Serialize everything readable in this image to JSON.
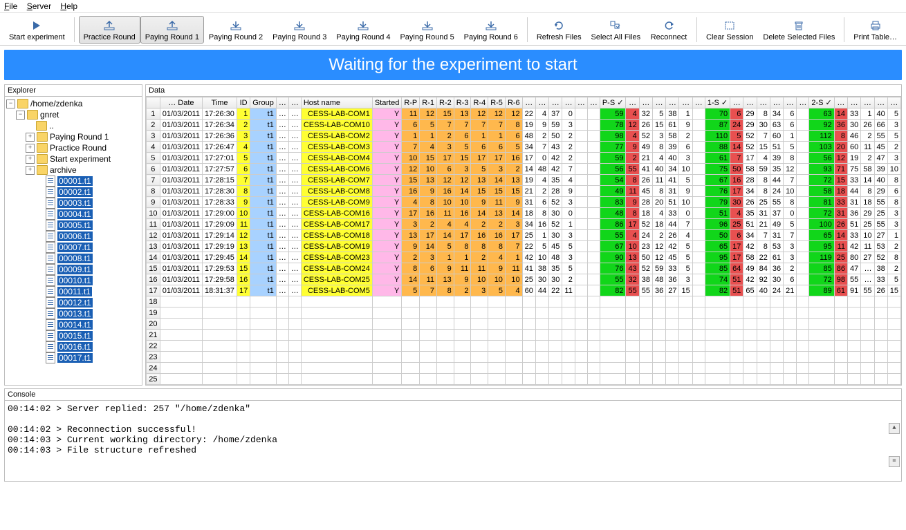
{
  "menubar": [
    "File",
    "Server",
    "Help"
  ],
  "banner": "Waiting for the experiment to start",
  "toolbar": [
    {
      "label": "Start experiment",
      "icon": "play"
    },
    {
      "label": "Practice Round",
      "icon": "upload",
      "pressed": true,
      "sepBefore": true
    },
    {
      "label": "Paying Round 1",
      "icon": "upload",
      "pressed": true
    },
    {
      "label": "Paying Round 2",
      "icon": "download"
    },
    {
      "label": "Paying Round 3",
      "icon": "download"
    },
    {
      "label": "Paying Round 4",
      "icon": "download"
    },
    {
      "label": "Paying Round 5",
      "icon": "download"
    },
    {
      "label": "Paying Round 6",
      "icon": "download"
    },
    {
      "label": "Refresh Files",
      "icon": "refresh",
      "sepBefore": true
    },
    {
      "label": "Select All Files",
      "icon": "select"
    },
    {
      "label": "Reconnect",
      "icon": "reconnect"
    },
    {
      "label": "Clear Session",
      "icon": "clear",
      "sepBefore": true
    },
    {
      "label": "Delete Selected Files",
      "icon": "trash"
    },
    {
      "label": "Print Table…",
      "icon": "print",
      "sepBefore": true
    }
  ],
  "explorer": {
    "title": "Explorer",
    "root": "/home/zdenka",
    "project": "gnret",
    "folders": [
      "..",
      "Paying Round 1",
      "Practice Round",
      "Start experiment",
      "archive"
    ],
    "files": [
      "00001.t1",
      "00002.t1",
      "00003.t1",
      "00004.t1",
      "00005.t1",
      "00006.t1",
      "00007.t1",
      "00008.t1",
      "00009.t1",
      "00010.t1",
      "00011.t1",
      "00012.t1",
      "00013.t1",
      "00014.t1",
      "00015.t1",
      "00016.t1",
      "00017.t1"
    ]
  },
  "dataPanel": {
    "title": "Data"
  },
  "grid": {
    "headers": [
      "",
      "… Date",
      "Time",
      "ID",
      "Group",
      "…",
      "…",
      "Host name",
      "Started",
      "R-P",
      "R-1",
      "R-2",
      "R-3",
      "R-4",
      "R-5",
      "R-6",
      "…",
      "…",
      "…",
      "…",
      "…",
      "…",
      "P-S ✓",
      "…",
      "…",
      "…",
      "…",
      "…",
      "…",
      "1-S ✓",
      "…",
      "…",
      "…",
      "…",
      "…",
      "…",
      "2-S ✓",
      "…",
      "…",
      "…",
      "…",
      "…"
    ],
    "classes": [
      "rowhead",
      "",
      "",
      "c-yel",
      "c-blu",
      "",
      "",
      "c-yel c-txt",
      "c-pnk",
      "c-org",
      "c-org",
      "c-org",
      "c-org",
      "c-org",
      "c-org",
      "c-org",
      "",
      "",
      "",
      "",
      "",
      "",
      "c-grn",
      "c-red",
      "",
      "",
      "",
      "",
      "",
      "c-grn",
      "c-red",
      "",
      "",
      "",
      "",
      "",
      "c-grn",
      "c-red",
      "",
      "",
      "",
      ""
    ],
    "rows": [
      [
        "1",
        "01/03/2011",
        "17:26:30",
        "1",
        "t1",
        "…",
        "…",
        "CESS-LAB-COM1",
        "Y",
        "11",
        "12",
        "15",
        "13",
        "12",
        "12",
        "12",
        "22",
        "4",
        "37",
        "0",
        "",
        "",
        "59",
        "4",
        "32",
        "5",
        "38",
        "1",
        "",
        "70",
        "6",
        "29",
        "8",
        "34",
        "6",
        "",
        "63",
        "14",
        "33",
        "1",
        "40",
        "5"
      ],
      [
        "2",
        "01/03/2011",
        "17:26:34",
        "2",
        "t1",
        "…",
        "…",
        "CESS-LAB-COM10",
        "Y",
        "6",
        "5",
        "7",
        "7",
        "7",
        "7",
        "8",
        "19",
        "9",
        "59",
        "3",
        "",
        "",
        "78",
        "12",
        "26",
        "15",
        "61",
        "9",
        "",
        "87",
        "24",
        "29",
        "30",
        "63",
        "6",
        "",
        "92",
        "36",
        "30",
        "26",
        "66",
        "3"
      ],
      [
        "3",
        "01/03/2011",
        "17:26:36",
        "3",
        "t1",
        "…",
        "…",
        "CESS-LAB-COM2",
        "Y",
        "1",
        "1",
        "2",
        "6",
        "1",
        "1",
        "6",
        "48",
        "2",
        "50",
        "2",
        "",
        "",
        "98",
        "4",
        "52",
        "3",
        "58",
        "2",
        "",
        "110",
        "5",
        "52",
        "7",
        "60",
        "1",
        "",
        "112",
        "8",
        "46",
        "2",
        "55",
        "5"
      ],
      [
        "4",
        "01/03/2011",
        "17:26:47",
        "4",
        "t1",
        "…",
        "…",
        "CESS-LAB-COM3",
        "Y",
        "7",
        "4",
        "3",
        "5",
        "6",
        "6",
        "5",
        "34",
        "7",
        "43",
        "2",
        "",
        "",
        "77",
        "9",
        "49",
        "8",
        "39",
        "6",
        "",
        "88",
        "14",
        "52",
        "15",
        "51",
        "5",
        "",
        "103",
        "20",
        "60",
        "11",
        "45",
        "2"
      ],
      [
        "5",
        "01/03/2011",
        "17:27:01",
        "5",
        "t1",
        "…",
        "…",
        "CESS-LAB-COM4",
        "Y",
        "10",
        "15",
        "17",
        "15",
        "17",
        "17",
        "16",
        "17",
        "0",
        "42",
        "2",
        "",
        "",
        "59",
        "2",
        "21",
        "4",
        "40",
        "3",
        "",
        "61",
        "7",
        "17",
        "4",
        "39",
        "8",
        "",
        "56",
        "12",
        "19",
        "2",
        "47",
        "3"
      ],
      [
        "6",
        "01/03/2011",
        "17:27:57",
        "6",
        "t1",
        "…",
        "…",
        "CESS-LAB-COM6",
        "Y",
        "12",
        "10",
        "6",
        "3",
        "5",
        "3",
        "2",
        "14",
        "48",
        "42",
        "7",
        "",
        "",
        "56",
        "55",
        "41",
        "40",
        "34",
        "10",
        "",
        "75",
        "50",
        "58",
        "59",
        "35",
        "12",
        "",
        "93",
        "71",
        "75",
        "58",
        "39",
        "10"
      ],
      [
        "7",
        "01/03/2011",
        "17:28:15",
        "7",
        "t1",
        "…",
        "…",
        "CESS-LAB-COM7",
        "Y",
        "15",
        "13",
        "12",
        "12",
        "13",
        "14",
        "13",
        "19",
        "4",
        "35",
        "4",
        "",
        "",
        "54",
        "8",
        "26",
        "11",
        "41",
        "5",
        "",
        "67",
        "16",
        "28",
        "8",
        "44",
        "7",
        "",
        "72",
        "15",
        "33",
        "14",
        "40",
        "8"
      ],
      [
        "8",
        "01/03/2011",
        "17:28:30",
        "8",
        "t1",
        "…",
        "…",
        "CESS-LAB-COM8",
        "Y",
        "16",
        "9",
        "16",
        "14",
        "15",
        "15",
        "15",
        "21",
        "2",
        "28",
        "9",
        "",
        "",
        "49",
        "11",
        "45",
        "8",
        "31",
        "9",
        "",
        "76",
        "17",
        "34",
        "8",
        "24",
        "10",
        "",
        "58",
        "18",
        "44",
        "8",
        "29",
        "6"
      ],
      [
        "9",
        "01/03/2011",
        "17:28:33",
        "9",
        "t1",
        "…",
        "…",
        "CESS-LAB-COM9",
        "Y",
        "4",
        "8",
        "10",
        "10",
        "9",
        "11",
        "9",
        "31",
        "6",
        "52",
        "3",
        "",
        "",
        "83",
        "9",
        "28",
        "20",
        "51",
        "10",
        "",
        "79",
        "30",
        "26",
        "25",
        "55",
        "8",
        "",
        "81",
        "33",
        "31",
        "18",
        "55",
        "8"
      ],
      [
        "10",
        "01/03/2011",
        "17:29:00",
        "10",
        "t1",
        "…",
        "…",
        "CESS-LAB-COM16",
        "Y",
        "17",
        "16",
        "11",
        "16",
        "14",
        "13",
        "14",
        "18",
        "8",
        "30",
        "0",
        "",
        "",
        "48",
        "8",
        "18",
        "4",
        "33",
        "0",
        "",
        "51",
        "4",
        "35",
        "31",
        "37",
        "0",
        "",
        "72",
        "31",
        "36",
        "29",
        "25",
        "3"
      ],
      [
        "11",
        "01/03/2011",
        "17:29:09",
        "11",
        "t1",
        "…",
        "…",
        "CESS-LAB-COM17",
        "Y",
        "3",
        "2",
        "4",
        "4",
        "2",
        "2",
        "3",
        "34",
        "16",
        "52",
        "1",
        "",
        "",
        "86",
        "17",
        "52",
        "18",
        "44",
        "7",
        "",
        "96",
        "25",
        "51",
        "21",
        "49",
        "5",
        "",
        "100",
        "26",
        "51",
        "25",
        "55",
        "3"
      ],
      [
        "12",
        "01/03/2011",
        "17:29:14",
        "12",
        "t1",
        "…",
        "…",
        "CESS-LAB-COM18",
        "Y",
        "13",
        "17",
        "14",
        "17",
        "16",
        "16",
        "17",
        "25",
        "1",
        "30",
        "3",
        "",
        "",
        "55",
        "4",
        "24",
        "2",
        "26",
        "4",
        "",
        "50",
        "6",
        "34",
        "7",
        "31",
        "7",
        "",
        "65",
        "14",
        "33",
        "10",
        "27",
        "1"
      ],
      [
        "13",
        "01/03/2011",
        "17:29:19",
        "13",
        "t1",
        "…",
        "…",
        "CESS-LAB-COM19",
        "Y",
        "9",
        "14",
        "5",
        "8",
        "8",
        "8",
        "7",
        "22",
        "5",
        "45",
        "5",
        "",
        "",
        "67",
        "10",
        "23",
        "12",
        "42",
        "5",
        "",
        "65",
        "17",
        "42",
        "8",
        "53",
        "3",
        "",
        "95",
        "11",
        "42",
        "11",
        "53",
        "2"
      ],
      [
        "14",
        "01/03/2011",
        "17:29:45",
        "14",
        "t1",
        "…",
        "…",
        "CESS-LAB-COM23",
        "Y",
        "2",
        "3",
        "1",
        "1",
        "2",
        "4",
        "1",
        "42",
        "10",
        "48",
        "3",
        "",
        "",
        "90",
        "13",
        "50",
        "12",
        "45",
        "5",
        "",
        "95",
        "17",
        "58",
        "22",
        "61",
        "3",
        "",
        "119",
        "25",
        "80",
        "27",
        "52",
        "8"
      ],
      [
        "15",
        "01/03/2011",
        "17:29:53",
        "15",
        "t1",
        "…",
        "…",
        "CESS-LAB-COM24",
        "Y",
        "8",
        "6",
        "9",
        "11",
        "11",
        "9",
        "11",
        "41",
        "38",
        "35",
        "5",
        "",
        "",
        "76",
        "43",
        "52",
        "59",
        "33",
        "5",
        "",
        "85",
        "64",
        "49",
        "84",
        "36",
        "2",
        "",
        "85",
        "86",
        "47",
        "…",
        "38",
        "2"
      ],
      [
        "16",
        "01/03/2011",
        "17:29:58",
        "16",
        "t1",
        "…",
        "…",
        "CESS-LAB-COM25",
        "Y",
        "14",
        "11",
        "13",
        "9",
        "10",
        "10",
        "10",
        "25",
        "30",
        "30",
        "2",
        "",
        "",
        "55",
        "32",
        "38",
        "48",
        "36",
        "3",
        "",
        "74",
        "51",
        "42",
        "92",
        "30",
        "6",
        "",
        "72",
        "98",
        "55",
        "…",
        "33",
        "5"
      ],
      [
        "17",
        "01/03/2011",
        "18:31:37",
        "17",
        "t1",
        "…",
        "…",
        "CESS-LAB-COM5",
        "Y",
        "5",
        "7",
        "8",
        "2",
        "3",
        "5",
        "4",
        "60",
        "44",
        "22",
        "11",
        "",
        "",
        "82",
        "55",
        "55",
        "36",
        "27",
        "15",
        "",
        "82",
        "51",
        "65",
        "40",
        "24",
        "21",
        "",
        "89",
        "61",
        "91",
        "55",
        "26",
        "15"
      ]
    ],
    "emptyRows": [
      "18",
      "19",
      "20",
      "21",
      "22",
      "23",
      "24",
      "25"
    ]
  },
  "console": {
    "title": "Console",
    "lines": [
      "00:14:02 > Server replied: 257 \"/home/zdenka\"",
      "",
      "00:14:02 > Reconnection successful!",
      "00:14:03 > Current working directory: /home/zdenka",
      "00:14:03 > File structure refreshed"
    ]
  }
}
